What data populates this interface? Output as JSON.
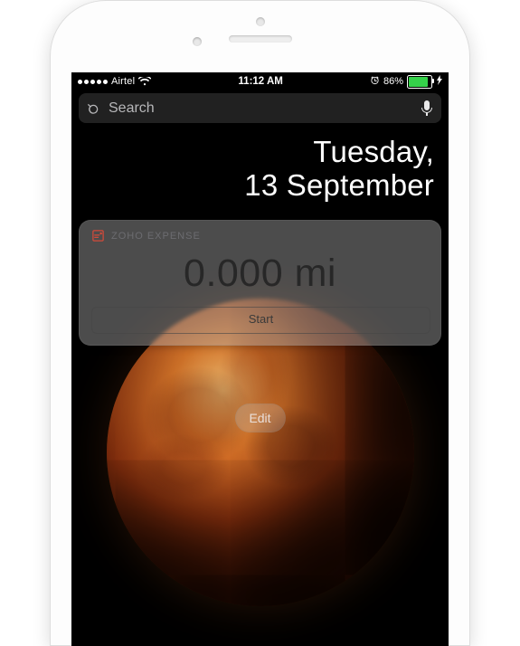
{
  "status_bar": {
    "carrier": "Airtel",
    "time": "11:12 AM",
    "battery_percent": "86%",
    "battery_fill_pct": 86
  },
  "search": {
    "placeholder": "Search"
  },
  "lock_date": {
    "day": "Tuesday,",
    "date": "13 September"
  },
  "widget": {
    "app_name": "ZOHO EXPENSE",
    "odometer": "0.000 mi",
    "start_label": "Start"
  },
  "edit_label": "Edit"
}
